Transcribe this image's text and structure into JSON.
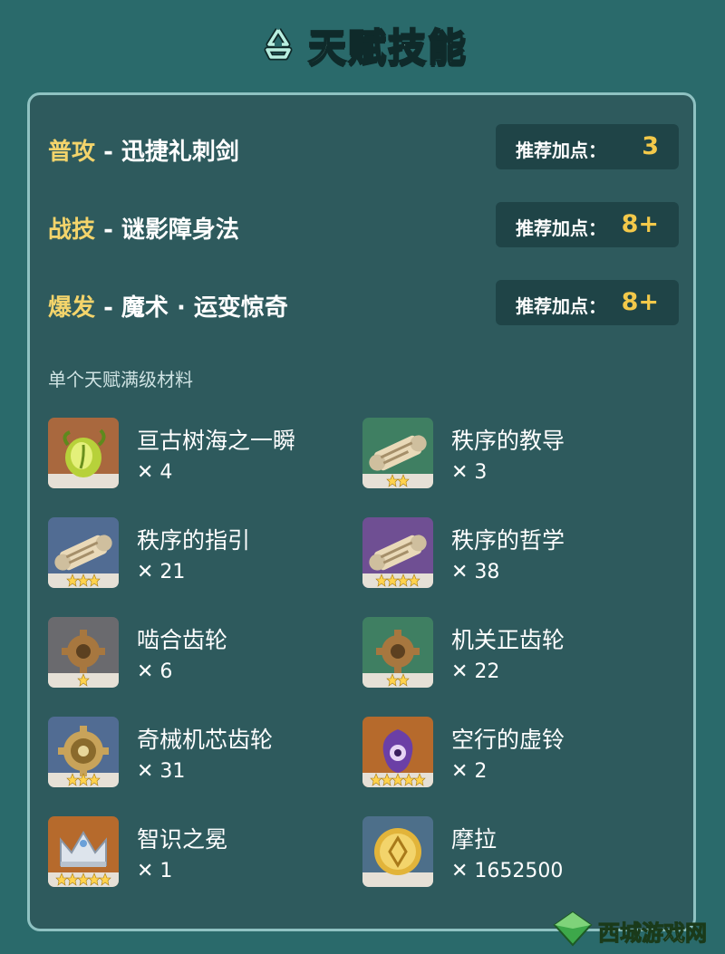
{
  "header": {
    "title": "天赋技能",
    "icon": "recycle-icon"
  },
  "skills": [
    {
      "type": "普攻",
      "name": "迅捷礼刺剑",
      "rec_label": "推荐加点：",
      "rec_value": "3"
    },
    {
      "type": "战技",
      "name": "谜影障身法",
      "rec_label": "推荐加点：",
      "rec_value": "8+"
    },
    {
      "type": "爆发",
      "name": "魔术 · 运变惊奇",
      "rec_label": "推荐加点：",
      "rec_value": "8+"
    }
  ],
  "materials_heading": "单个天赋满级材料",
  "materials": [
    {
      "name": "亘古树海之一瞬",
      "count": "✕ 4",
      "icon": "green-sprout-icon",
      "stars": 0,
      "bg": "#a9683e"
    },
    {
      "name": "秩序的教导",
      "count": "✕ 3",
      "icon": "scroll-icon",
      "stars": 2,
      "bg": "#3f7f62"
    },
    {
      "name": "秩序的指引",
      "count": "✕ 21",
      "icon": "scroll-icon",
      "stars": 3,
      "bg": "#516c93"
    },
    {
      "name": "秩序的哲学",
      "count": "✕ 38",
      "icon": "scroll-icon",
      "stars": 4,
      "bg": "#6f4f93"
    },
    {
      "name": "啮合齿轮",
      "count": "✕ 6",
      "icon": "gear-icon",
      "stars": 1,
      "bg": "#6a6a6e"
    },
    {
      "name": "机关正齿轮",
      "count": "✕ 22",
      "icon": "gear-icon",
      "stars": 2,
      "bg": "#3f7f62"
    },
    {
      "name": "奇械机芯齿轮",
      "count": "✕ 31",
      "icon": "clockwork-gear-icon",
      "stars": 3,
      "bg": "#516c93"
    },
    {
      "name": "空行的虚铃",
      "count": "✕ 2",
      "icon": "bell-icon",
      "stars": 5,
      "bg": "#b66a2c"
    },
    {
      "name": "智识之冕",
      "count": "✕ 1",
      "icon": "crown-icon",
      "stars": 5,
      "bg": "#b66a2c"
    },
    {
      "name": "摩拉",
      "count": "✕ 1652500",
      "icon": "mora-coin-icon",
      "stars": 0,
      "bg": "#4d6f8a"
    }
  ],
  "watermark": {
    "text": "西城游戏网",
    "icon": "diamond-logo-icon"
  },
  "colors": {
    "background": "#2a6a6b",
    "panel": "#2e5a5d",
    "accent_yellow": "#f3d46b",
    "rec_box": "#1f4447"
  }
}
